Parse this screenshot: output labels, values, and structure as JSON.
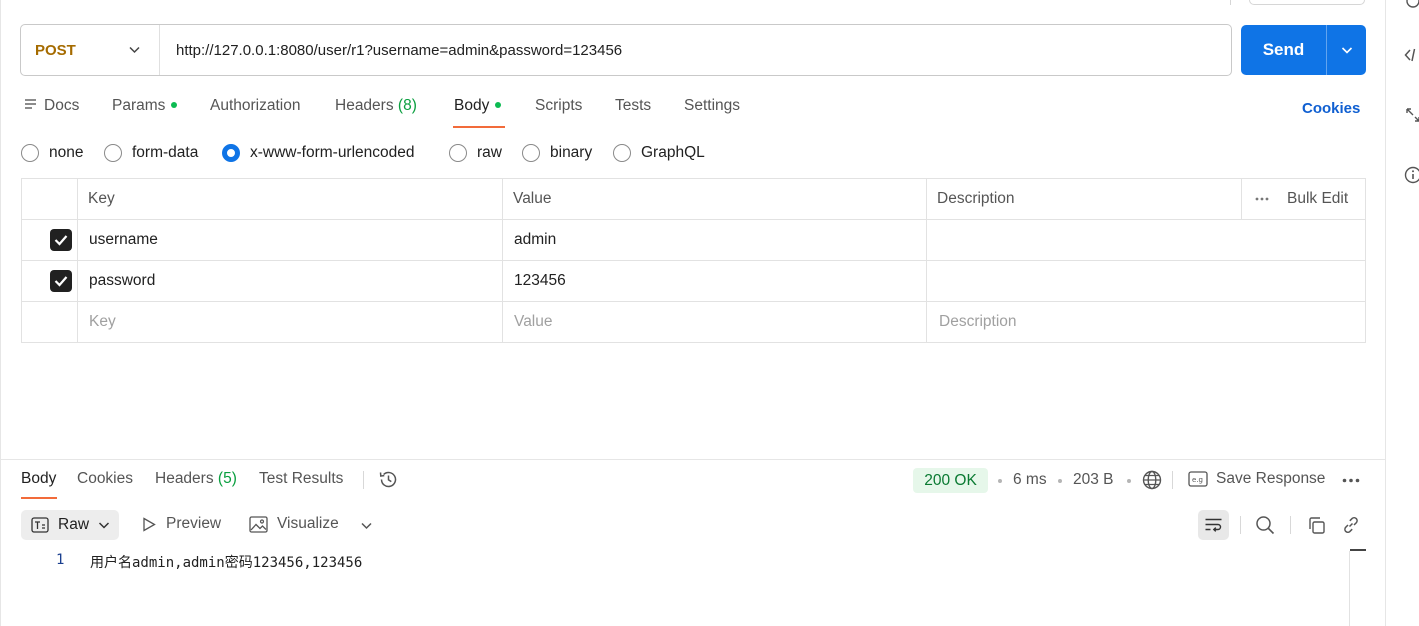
{
  "request": {
    "method": "POST",
    "url": "http://127.0.0.1:8080/user/r1?username=admin&password=123456",
    "send_label": "Send"
  },
  "tabs": {
    "docs": "Docs",
    "params": "Params",
    "authorization": "Authorization",
    "headers": "Headers",
    "headers_count": "(8)",
    "body": "Body",
    "scripts": "Scripts",
    "tests": "Tests",
    "settings": "Settings",
    "cookies": "Cookies"
  },
  "body_modes": {
    "none": "none",
    "form_data": "form-data",
    "urlencoded": "x-www-form-urlencoded",
    "raw": "raw",
    "binary": "binary",
    "graphql": "GraphQL",
    "selected": "x-www-form-urlencoded"
  },
  "table": {
    "headers": {
      "key": "Key",
      "value": "Value",
      "description": "Description",
      "bulk_edit": "Bulk Edit"
    },
    "rows": [
      {
        "key": "username",
        "value": "admin",
        "description": "",
        "checked": true
      },
      {
        "key": "password",
        "value": "123456",
        "description": "",
        "checked": true
      }
    ],
    "placeholders": {
      "key": "Key",
      "value": "Value",
      "description": "Description"
    }
  },
  "response": {
    "tabs": {
      "body": "Body",
      "cookies": "Cookies",
      "headers": "Headers",
      "headers_count": "(5)",
      "test_results": "Test Results"
    },
    "status": "200 OK",
    "time": "6 ms",
    "size": "203 B",
    "save_response": "Save Response",
    "format": "Raw",
    "preview": "Preview",
    "visualize": "Visualize",
    "lines": [
      {
        "number": "1",
        "text": "用户名admin,admin密码123456,123456"
      }
    ]
  },
  "colors": {
    "accent": "#0f74e6",
    "tab_indicator": "#f26b3a",
    "method_post": "#a56b00",
    "status_ok_bg": "#e6f7ea",
    "status_ok_text": "#0a7a32",
    "dot_green": "#0cbb52"
  }
}
